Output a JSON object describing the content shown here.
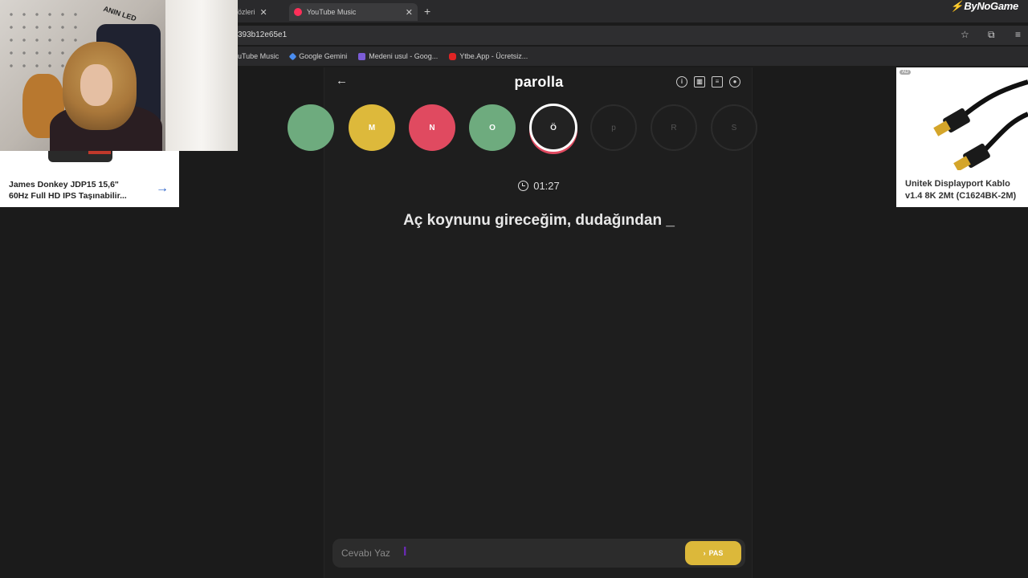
{
  "browser": {
    "tabs": [
      {
        "label": "özleri",
        "active": false
      },
      {
        "label": "YouTube Music",
        "active": true
      }
    ],
    "new_tab": "+",
    "url": "393b12e65e1",
    "bookmarks": [
      {
        "label": "uTube Music",
        "icon": "youtube-music-icon"
      },
      {
        "label": "Google Gemini",
        "icon": "gemini-icon"
      },
      {
        "label": "Medeni usul - Goog...",
        "icon": "docs-icon"
      },
      {
        "label": "Ytbe.App - Ücretsiz...",
        "icon": "youtube-icon"
      }
    ],
    "overlay_brand": "ByNoGame"
  },
  "webcam": {
    "sign_text": "ANIN LED"
  },
  "ads": {
    "left": {
      "title": "James Donkey JDP15 15,6\" 60Hz Full HD IPS Taşınabilir..."
    },
    "right": {
      "badge": "AD",
      "title": "Unitek Displayport Kablo v1.4 8K 2Mt (C1624BK-2M)"
    }
  },
  "game": {
    "title": "parolla",
    "letters": [
      {
        "letter": "",
        "state": "correct"
      },
      {
        "letter": "M",
        "state": "passed"
      },
      {
        "letter": "N",
        "state": "wrong"
      },
      {
        "letter": "O",
        "state": "correct"
      },
      {
        "letter": "Ö",
        "state": "current"
      },
      {
        "letter": "P",
        "state": "future"
      },
      {
        "letter": "R",
        "state": "future"
      },
      {
        "letter": "S",
        "state": "future"
      }
    ],
    "timer": "01:27",
    "question": "Aç koynunu gireceğim, dudağından _",
    "answer_placeholder": "Cevabı Yaz",
    "pass_label": "PAS"
  },
  "colors": {
    "correct": "#6eab7e",
    "passed": "#ddb93b",
    "wrong": "#e04a60",
    "pass_button": "#dcb83a",
    "background": "#1b1b1b"
  }
}
